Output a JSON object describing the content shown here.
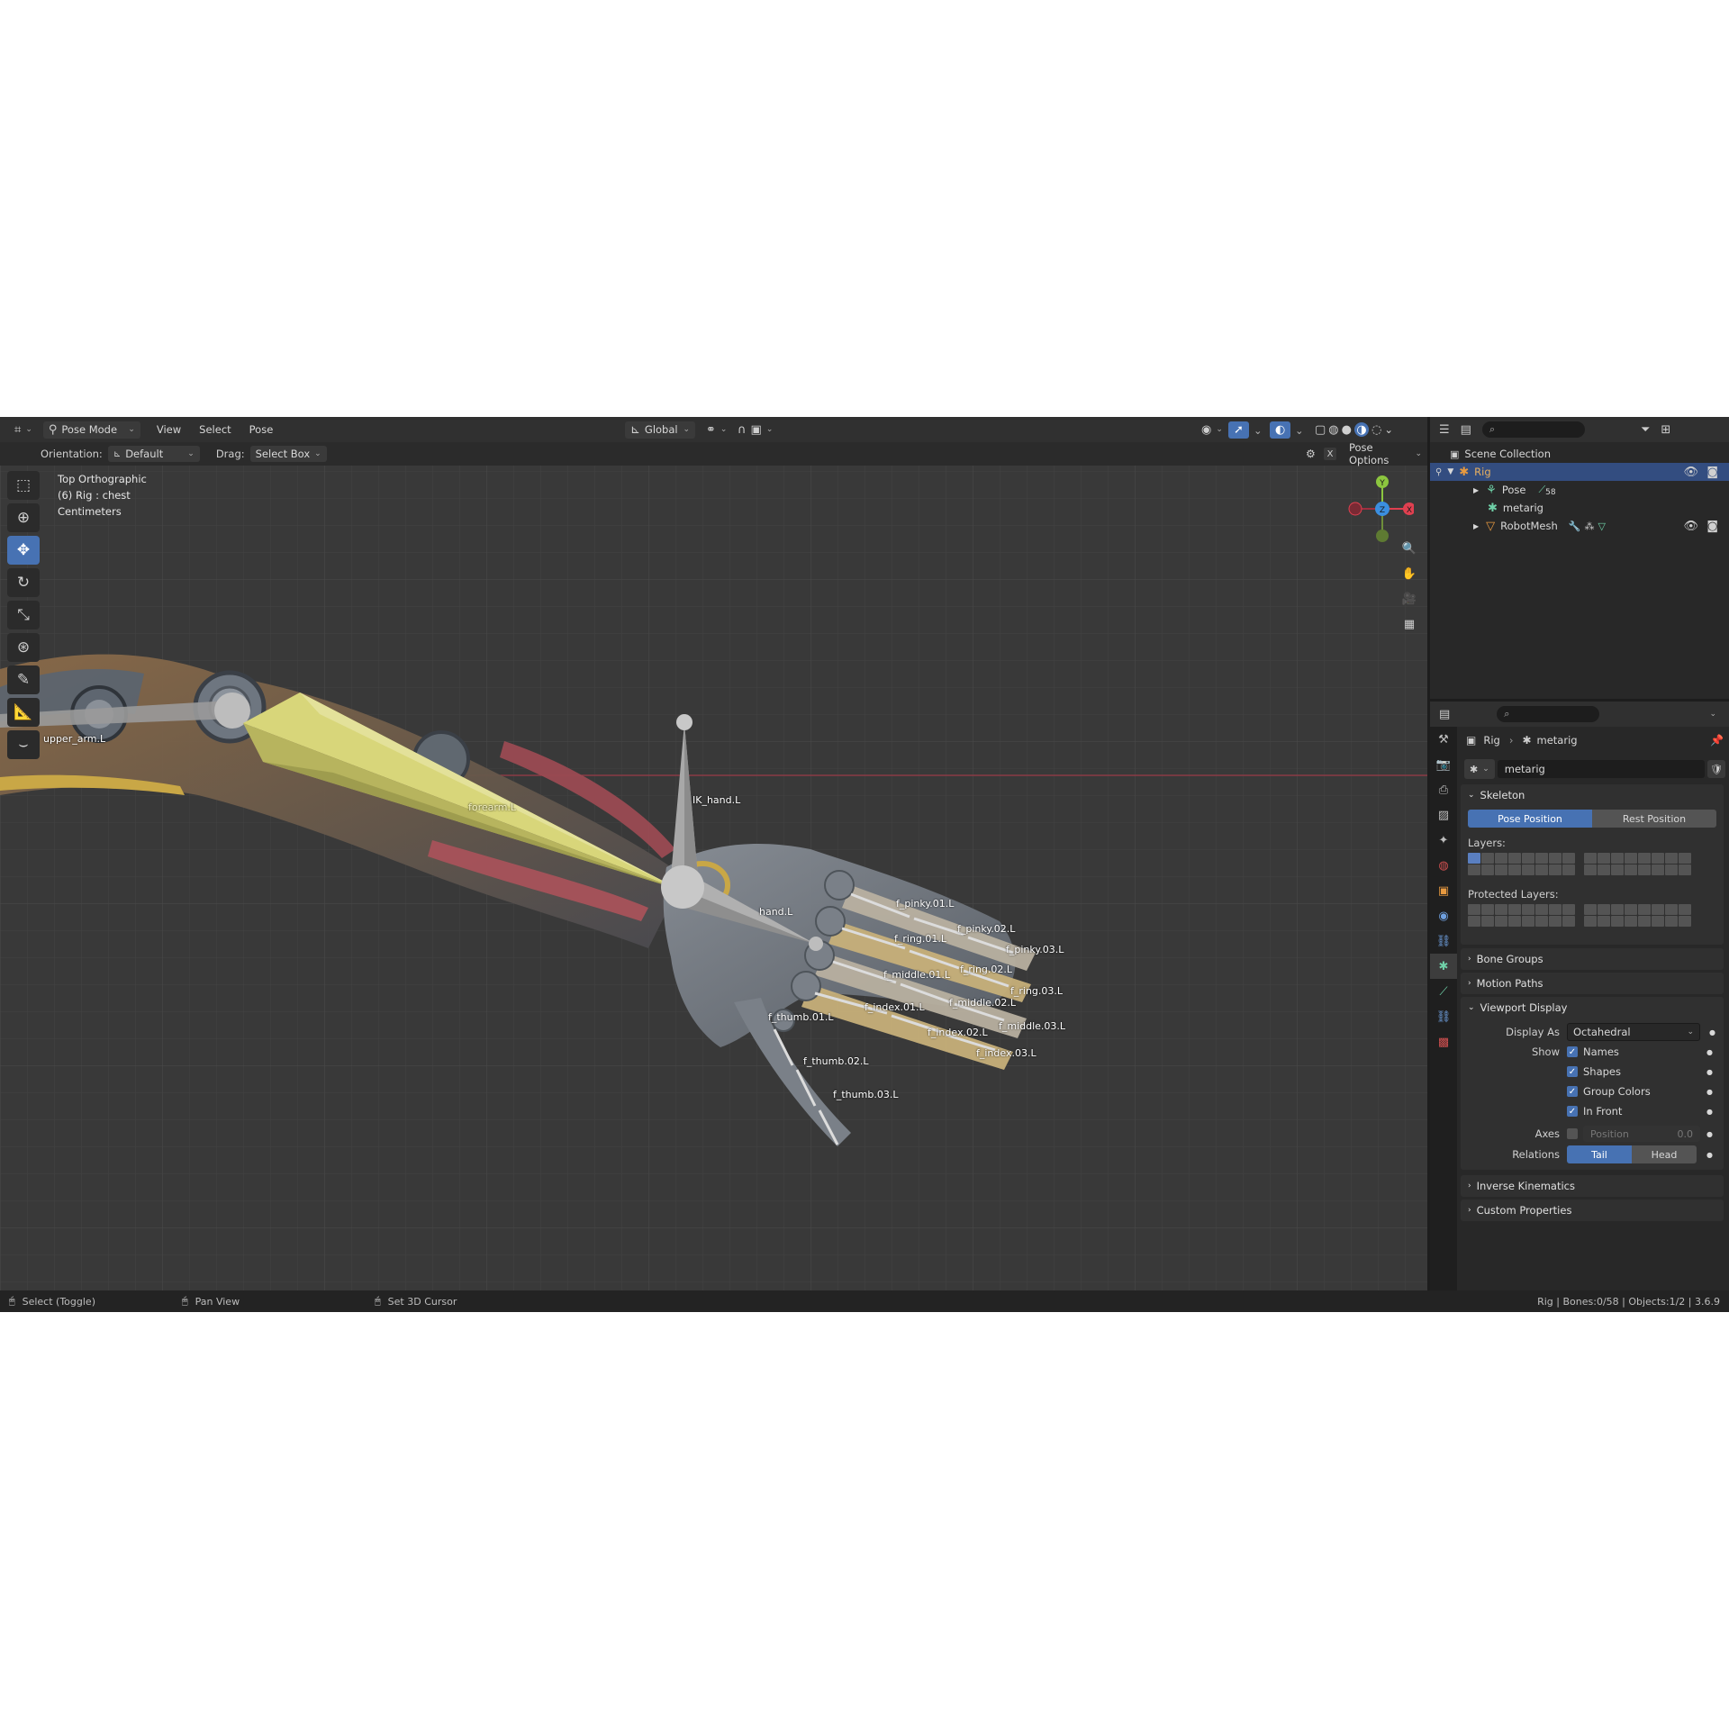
{
  "header": {
    "mode_label": "Pose Mode",
    "menus": [
      "View",
      "Select",
      "Pose"
    ],
    "transform_label": "Global",
    "orientation_label": "Orientation:",
    "orientation_value": "Default",
    "drag_label": "Drag:",
    "drag_value": "Select Box",
    "pose_options": "Pose Options"
  },
  "viewport": {
    "view_name": "Top Orthographic",
    "object_info": "(6) Rig : chest",
    "units": "Centimeters",
    "gizmo": {
      "y": "Y",
      "x": "X",
      "z": "Z"
    },
    "bones": {
      "upper_arm": "upper_arm.L",
      "forearm": "forearm.L",
      "ik_hand": "IK_hand.L",
      "hand": "hand.L",
      "pinky1": "f_pinky.01.L",
      "pinky2": "f_pinky.02.L",
      "pinky3": "f_pinky.03.L",
      "ring1": "f_ring.01.L",
      "ring2": "f_ring.02.L",
      "ring3": "f_ring.03.L",
      "middle1": "f_middle.01.L",
      "middle2": "f_middle.02.L",
      "middle3": "f_middle.03.L",
      "index1": "f_index.01.L",
      "index2": "f_index.02.L",
      "index3": "f_index.03.L",
      "thumb1": "f_thumb.01.L",
      "thumb2": "f_thumb.02.L",
      "thumb3": "f_thumb.03.L"
    }
  },
  "outliner": {
    "scene_collection": "Scene Collection",
    "rig": "Rig",
    "pose": "Pose",
    "pose_count": "58",
    "metarig": "metarig",
    "robotmesh": "RobotMesh"
  },
  "properties": {
    "breadcrumb_rig": "Rig",
    "breadcrumb_data": "metarig",
    "data_name": "metarig",
    "skeleton": "Skeleton",
    "pose_position": "Pose Position",
    "rest_position": "Rest Position",
    "layers": "Layers:",
    "protected_layers": "Protected Layers:",
    "bone_groups": "Bone Groups",
    "motion_paths": "Motion Paths",
    "viewport_display": "Viewport Display",
    "display_as_label": "Display As",
    "display_as_value": "Octahedral",
    "show_label": "Show",
    "names": "Names",
    "shapes": "Shapes",
    "group_colors": "Group Colors",
    "in_front": "In Front",
    "axes_label": "Axes",
    "position_label": "Position",
    "position_value": "0.0",
    "relations_label": "Relations",
    "tail": "Tail",
    "head": "Head",
    "inverse_kinematics": "Inverse Kinematics",
    "custom_properties": "Custom Properties"
  },
  "status": {
    "select": "Select (Toggle)",
    "pan": "Pan View",
    "cursor": "Set 3D Cursor",
    "info": "Rig | Bones:0/58 | Objects:1/2 | 3.6.9"
  },
  "colors": {
    "accent": "#4772b3",
    "bone_active": "#d8d67a",
    "axis_x": "#e04050",
    "axis_y": "#8cc63f",
    "axis_z": "#3b8fe0"
  }
}
